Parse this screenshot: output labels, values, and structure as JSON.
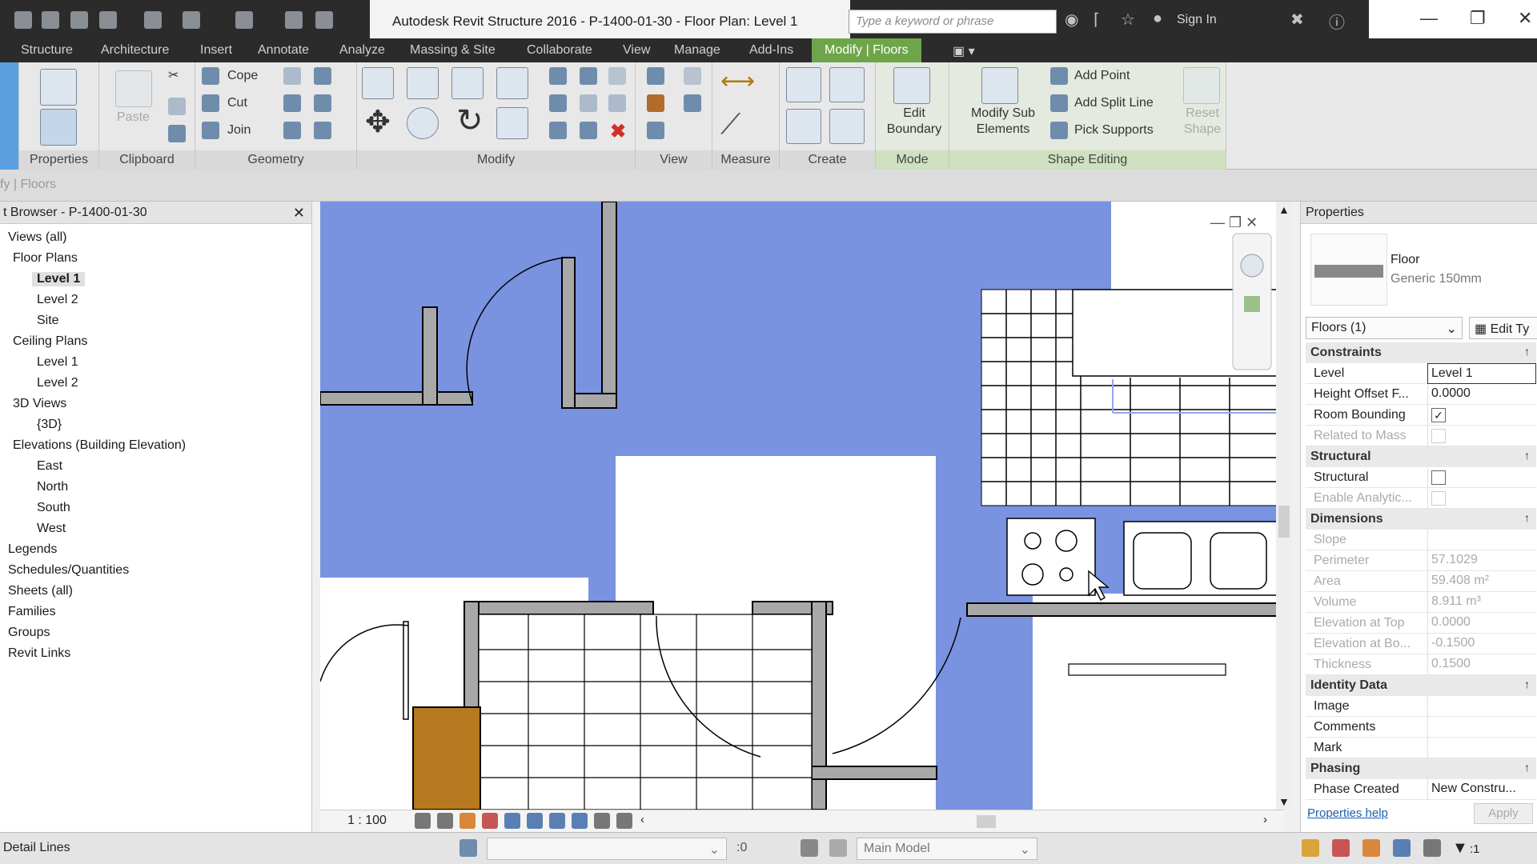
{
  "window": {
    "title": "Autodesk Revit Structure 2016 -    P-1400-01-30 - Floor Plan: Level 1",
    "search_placeholder": "Type a keyword or phrase",
    "sign_in": "Sign In"
  },
  "ribbon_tabs": [
    "Structure",
    "Architecture",
    "Insert",
    "Annotate",
    "Analyze",
    "Massing & Site",
    "Collaborate",
    "View",
    "Manage",
    "Add-Ins",
    "Modify | Floors"
  ],
  "active_tab": "Modify | Floors",
  "ribbon": {
    "panels": {
      "properties": "Properties",
      "clipboard": "Clipboard",
      "geometry": "Geometry",
      "modify": "Modify",
      "view": "View",
      "measure": "Measure",
      "create": "Create",
      "mode": "Mode",
      "shape_editing": "Shape Editing"
    },
    "paste": "Paste",
    "cope": "Cope",
    "cut": "Cut",
    "join": "Join",
    "edit_boundary": "Edit Boundary",
    "modify_sub_elements": "Modify Sub Elements",
    "add_point": "Add Point",
    "add_split_line": "Add Split Line",
    "pick_supports": "Pick Supports",
    "reset_shape": "Reset Shape"
  },
  "options_bar": "fy | Floors",
  "browser": {
    "title": "t Browser - P-1400-01-30",
    "items": [
      {
        "label": "Views (all)",
        "selected": false
      },
      {
        "label": "Floor Plans",
        "selected": false
      },
      {
        "label": "Level 1",
        "selected": true
      },
      {
        "label": "Level 2",
        "selected": false
      },
      {
        "label": "Site",
        "selected": false
      },
      {
        "label": "Ceiling Plans",
        "selected": false
      },
      {
        "label": "Level 1",
        "selected": false
      },
      {
        "label": "Level 2",
        "selected": false
      },
      {
        "label": "3D Views",
        "selected": false
      },
      {
        "label": "{3D}",
        "selected": false
      },
      {
        "label": "Elevations (Building Elevation)",
        "selected": false
      },
      {
        "label": "East",
        "selected": false
      },
      {
        "label": "North",
        "selected": false
      },
      {
        "label": "South",
        "selected": false
      },
      {
        "label": "West",
        "selected": false
      },
      {
        "label": "Legends",
        "selected": false
      },
      {
        "label": "Schedules/Quantities",
        "selected": false
      },
      {
        "label": "Sheets (all)",
        "selected": false
      },
      {
        "label": "Families",
        "selected": false
      },
      {
        "label": "Groups",
        "selected": false
      },
      {
        "label": "Revit Links",
        "selected": false
      }
    ]
  },
  "view": {
    "scale": "1 : 100"
  },
  "properties": {
    "title": "Properties",
    "type_family": "Floor",
    "type_name": "Generic 150mm",
    "instance_selector": "Floors (1)",
    "edit_type": "Edit Ty",
    "groups": {
      "constraints": "Constraints",
      "structural": "Structural",
      "dimensions": "Dimensions",
      "identity": "Identity Data",
      "phasing": "Phasing"
    },
    "rows": {
      "level": {
        "label": "Level",
        "value": "Level 1"
      },
      "height_offset": {
        "label": "Height Offset F...",
        "value": "0.0000"
      },
      "room_bounding": {
        "label": "Room Bounding",
        "checked": true
      },
      "related_to_mass": {
        "label": "Related to Mass"
      },
      "structural": {
        "label": "Structural",
        "checked": false
      },
      "enable_analytic": {
        "label": "Enable Analytic..."
      },
      "slope": {
        "label": "Slope",
        "value": ""
      },
      "perimeter": {
        "label": "Perimeter",
        "value": "57.1029"
      },
      "area": {
        "label": "Area",
        "value": "59.408 m²"
      },
      "volume": {
        "label": "Volume",
        "value": "8.911 m³"
      },
      "elevation_top": {
        "label": "Elevation at Top",
        "value": "0.0000"
      },
      "elevation_bottom": {
        "label": "Elevation at Bo...",
        "value": "-0.1500"
      },
      "thickness": {
        "label": "Thickness",
        "value": "0.1500"
      },
      "image": {
        "label": "Image",
        "value": ""
      },
      "comments": {
        "label": "Comments",
        "value": ""
      },
      "mark": {
        "label": "Mark",
        "value": ""
      },
      "phase_created": {
        "label": "Phase Created",
        "value": "New Constru..."
      }
    },
    "help_link": "Properties help",
    "apply": "Apply"
  },
  "status": {
    "left": "Detail Lines",
    "worksets": ":0",
    "model": "Main Model",
    "filter_count": ":1"
  },
  "colors": {
    "accent_tab": "#6fa54a",
    "floor_selection": "#7a93e0",
    "wall": "#a8a8a8",
    "column": "#b7791f"
  }
}
